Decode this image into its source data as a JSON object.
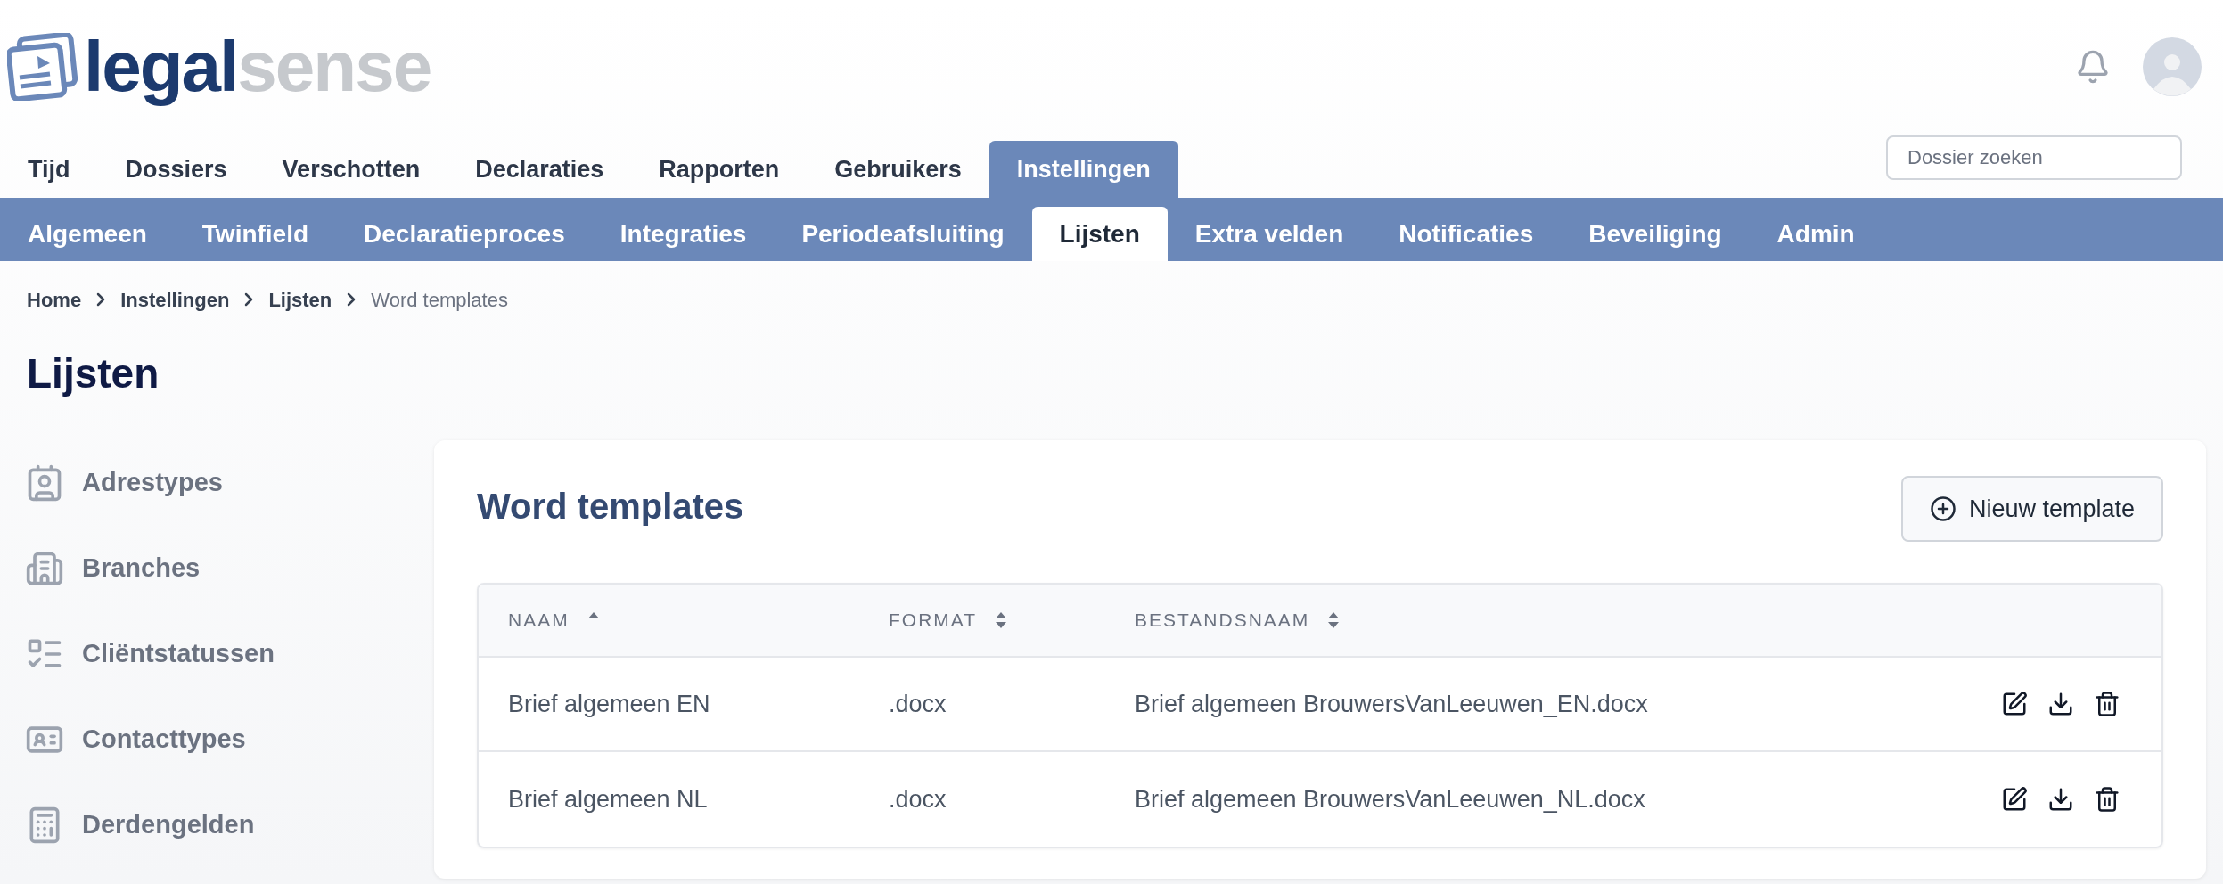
{
  "logo": {
    "primary": "legal",
    "secondary": "sense"
  },
  "search": {
    "placeholder": "Dossier zoeken"
  },
  "main_nav": [
    {
      "label": "Tijd",
      "selected": false
    },
    {
      "label": "Dossiers",
      "selected": false
    },
    {
      "label": "Verschotten",
      "selected": false
    },
    {
      "label": "Declaraties",
      "selected": false
    },
    {
      "label": "Rapporten",
      "selected": false
    },
    {
      "label": "Gebruikers",
      "selected": false
    },
    {
      "label": "Instellingen",
      "selected": true
    }
  ],
  "sub_nav": [
    {
      "label": "Algemeen",
      "selected": false
    },
    {
      "label": "Twinfield",
      "selected": false
    },
    {
      "label": "Declaratieproces",
      "selected": false
    },
    {
      "label": "Integraties",
      "selected": false
    },
    {
      "label": "Periodeafsluiting",
      "selected": false
    },
    {
      "label": "Lijsten",
      "selected": true
    },
    {
      "label": "Extra velden",
      "selected": false
    },
    {
      "label": "Notificaties",
      "selected": false
    },
    {
      "label": "Beveiliging",
      "selected": false
    },
    {
      "label": "Admin",
      "selected": false
    }
  ],
  "breadcrumb": [
    {
      "label": "Home",
      "current": false
    },
    {
      "label": "Instellingen",
      "current": false
    },
    {
      "label": "Lijsten",
      "current": false
    },
    {
      "label": "Word templates",
      "current": true
    }
  ],
  "page_title": "Lijsten",
  "sidebar": {
    "items": [
      "Adrestypes",
      "Branches",
      "Cliëntstatussen",
      "Contacttypes",
      "Derdengelden"
    ]
  },
  "card": {
    "title": "Word templates",
    "new_button": "Nieuw template",
    "columns": [
      {
        "label": "NAAM",
        "sorted": true
      },
      {
        "label": "FORMAT",
        "sorted": false
      },
      {
        "label": "BESTANDSNAAM",
        "sorted": false
      }
    ],
    "rows": [
      [
        "Brief algemeen EN",
        ".docx",
        "Brief algemeen BrouwersVanLeeuwen_EN.docx"
      ],
      [
        "Brief algemeen NL",
        ".docx",
        "Brief algemeen BrouwersVanLeeuwen_NL.docx"
      ]
    ]
  }
}
